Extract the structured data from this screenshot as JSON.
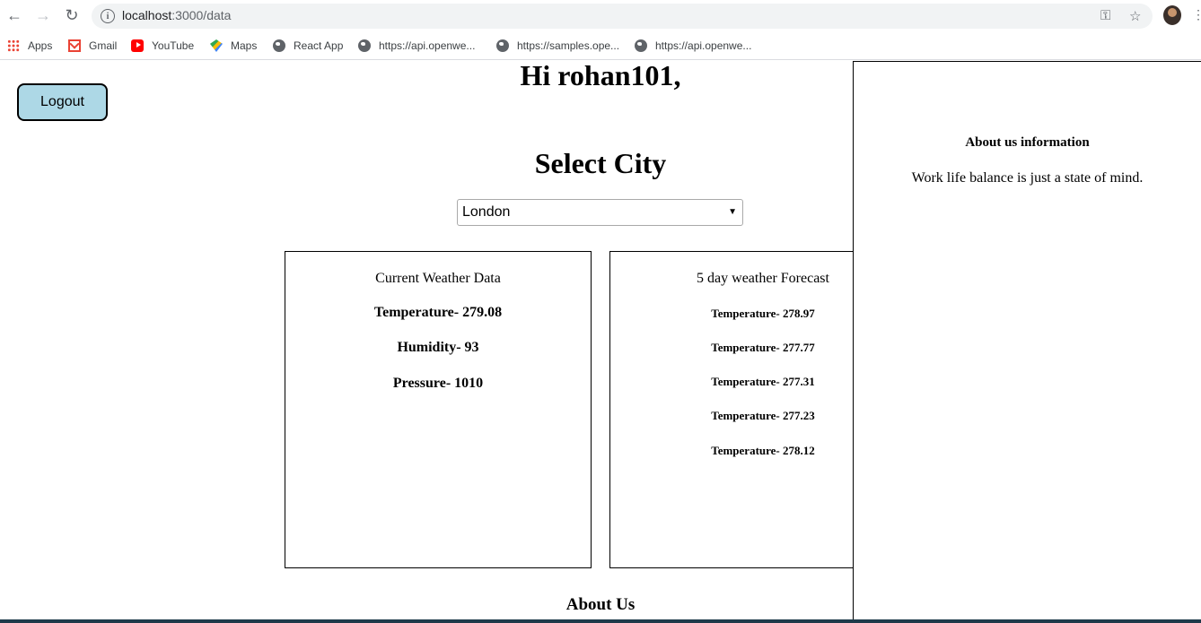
{
  "browser": {
    "url_host": "localhost",
    "url_path": ":3000/data",
    "bookmarks": [
      {
        "label": "Apps",
        "icon": "apps-icon"
      },
      {
        "label": "Gmail",
        "icon": "gmail-icon"
      },
      {
        "label": "YouTube",
        "icon": "youtube-icon"
      },
      {
        "label": "Maps",
        "icon": "maps-icon"
      },
      {
        "label": "React App",
        "icon": "globe-icon"
      },
      {
        "label": "https://api.openwe...",
        "icon": "globe-icon"
      },
      {
        "label": "https://samples.ope...",
        "icon": "globe-icon"
      },
      {
        "label": "https://api.openwe...",
        "icon": "globe-icon"
      }
    ]
  },
  "page": {
    "logout_label": "Logout",
    "greeting": "Hi rohan101,",
    "select_title": "Select City",
    "selected_city": "London",
    "current": {
      "title": "Current Weather Data",
      "temperature": "Temperature- 279.08",
      "humidity": "Humidity- 93",
      "pressure": "Pressure- 1010"
    },
    "forecast": {
      "title": "5 day weather Forecast",
      "temps": [
        "Temperature- 278.97",
        "Temperature- 277.77",
        "Temperature- 277.31",
        "Temperature- 277.23",
        "Temperature- 278.12"
      ]
    },
    "about_us": "About Us"
  },
  "sidebar": {
    "title": "About us information",
    "text": "Work life balance is just a state of mind."
  },
  "colors": {
    "logout_bg": "#add8e6",
    "omnibox_bg": "#f1f3f4"
  }
}
